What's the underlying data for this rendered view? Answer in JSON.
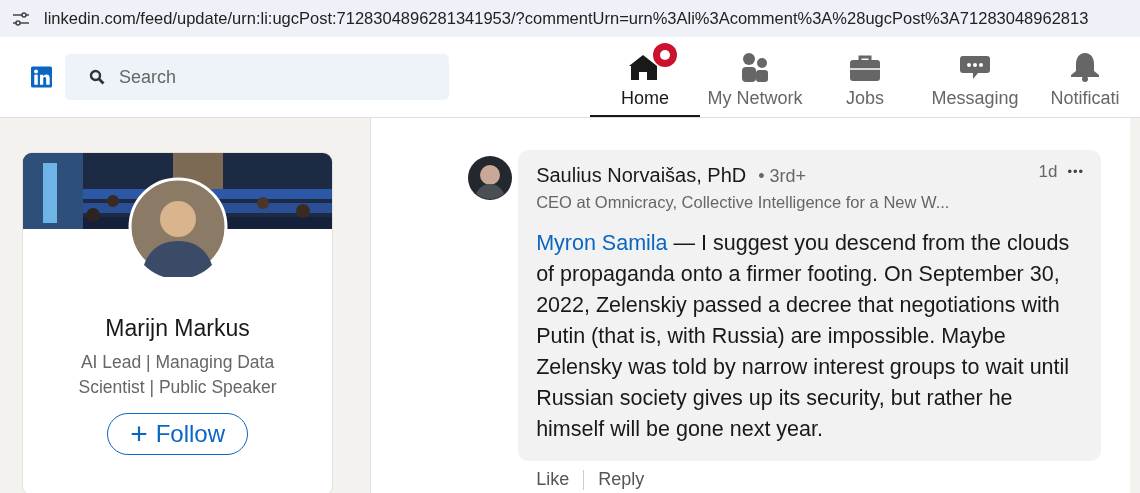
{
  "address_bar": {
    "url": "linkedin.com/feed/update/urn:li:ugcPost:7128304896281341953/?commentUrn=urn%3Ali%3Acomment%3A%28ugcPost%3A71283048962813"
  },
  "header": {
    "search": {
      "placeholder": "Search"
    },
    "nav": [
      {
        "label": "Home",
        "selected": true,
        "badge": true
      },
      {
        "label": "My Network",
        "selected": false,
        "badge": false
      },
      {
        "label": "Jobs",
        "selected": false,
        "badge": false
      },
      {
        "label": "Messaging",
        "selected": false,
        "badge": false
      },
      {
        "label": "Notificati",
        "selected": false,
        "badge": false
      }
    ]
  },
  "profile_card": {
    "name": "Marijn Markus",
    "headline": "AI Lead | Managing Data Scientist | Public Speaker",
    "follow_button": "Follow",
    "follow_icon": "+"
  },
  "comments": {
    "reply": {
      "author": "Saulius Norvaišas, PhD",
      "degree": "• 3rd+",
      "headline": "CEO at Omnicracy, Collective Intelligence for a New W...",
      "time": "1d",
      "more": "•••",
      "mention": "Myron Samila",
      "text": " — I suggest you descend from the clouds of propaganda onto a firmer footing. On September 30, 2022, Zelenskiy passed a decree that negotiations with Putin (that is, with Russia) are impossible. Maybe Zelensky was told by narrow interest groups to wait until Russian society gives up its security, but rather he himself will be gone next year.",
      "actions": [
        "Like",
        "Reply"
      ]
    }
  }
}
